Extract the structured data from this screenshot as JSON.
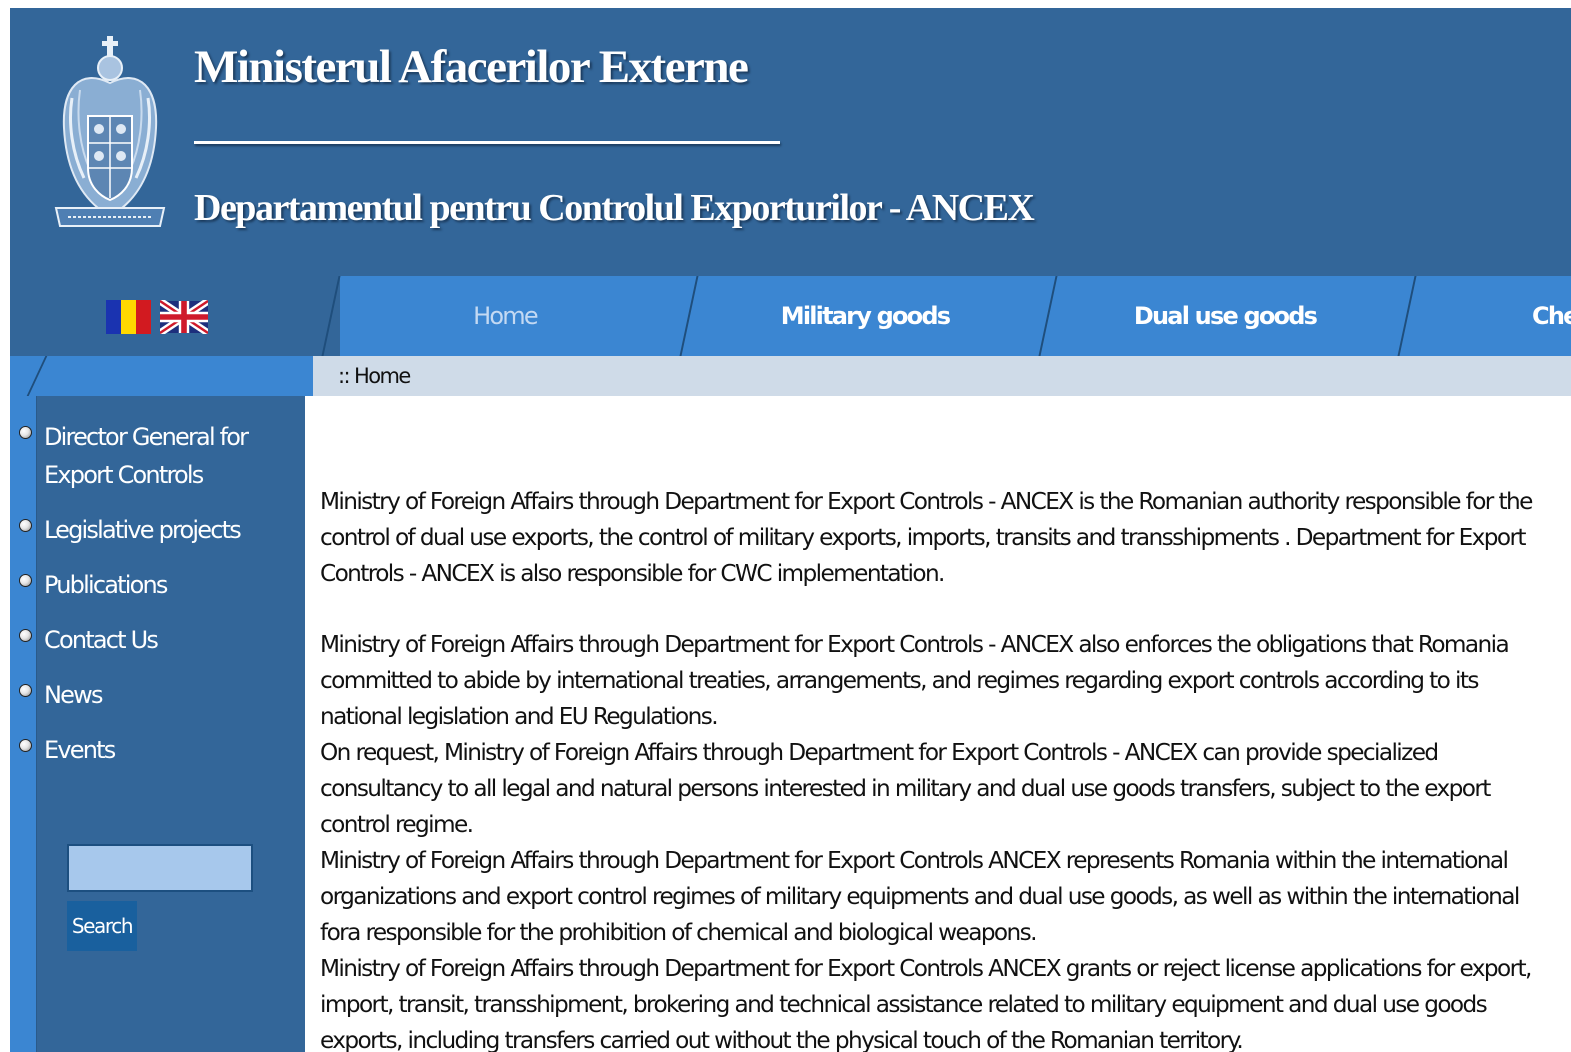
{
  "header": {
    "title": "Ministerul Afacerilor Externe",
    "subtitle": "Departamentul pentru Controlul Exporturilor  -  ANCEX"
  },
  "languages": [
    "ro-flag-icon",
    "uk-flag-icon"
  ],
  "nav": {
    "items": [
      {
        "label": "Home"
      },
      {
        "label": "Military goods"
      },
      {
        "label": "Dual use goods"
      },
      {
        "label": "Che"
      }
    ]
  },
  "breadcrumb": ":: Home",
  "sidebar": {
    "items": [
      {
        "label": "Director General for Export Controls"
      },
      {
        "label": "Legislative projects"
      },
      {
        "label": "Publications"
      },
      {
        "label": "Contact Us"
      },
      {
        "label": "News"
      },
      {
        "label": "Events"
      }
    ],
    "search": {
      "value": "",
      "button_label": "Search"
    }
  },
  "main": {
    "paragraphs": [
      "Ministry of Foreign Affairs through Department for Export Controls -  ANCEX is the Romanian authority responsible for the control of dual use exports, the control of military exports, imports, transits and transshipments . Department for Export Controls - ANCEX is also responsible for CWC implementation.",
      "Ministry of Foreign Affairs through Department for Export Controls - ANCEX also enforces the obligations that Romania committed to abide by international treaties, arrangements, and regimes regarding export controls according to its national legislation and EU Regulations.",
      "On request, Ministry of Foreign Affairs through Department for Export Controls - ANCEX can provide specialized consultancy to all legal and natural persons interested in military and dual use goods transfers, subject to the export control regime.",
      "Ministry of Foreign Affairs through Department for Export Controls ANCEX represents Romania within the international organizations and export control regimes of military equipments and dual use goods, as well as within the international fora responsible for the prohibition of chemical and biological weapons.",
      "Ministry of Foreign Affairs through Department for Export Controls ANCEX grants or reject license applications for export, import, transit, transshipment, brokering and technical assistance related to military equipment and dual use goods exports, including transfers carried out without the physical touch of the Romanian territory."
    ]
  },
  "colors": {
    "header_bg": "#336699",
    "nav_bg": "#3b86d2",
    "breadcrumb_bg": "#cfdbe8",
    "search_button_bg": "#19609e"
  }
}
